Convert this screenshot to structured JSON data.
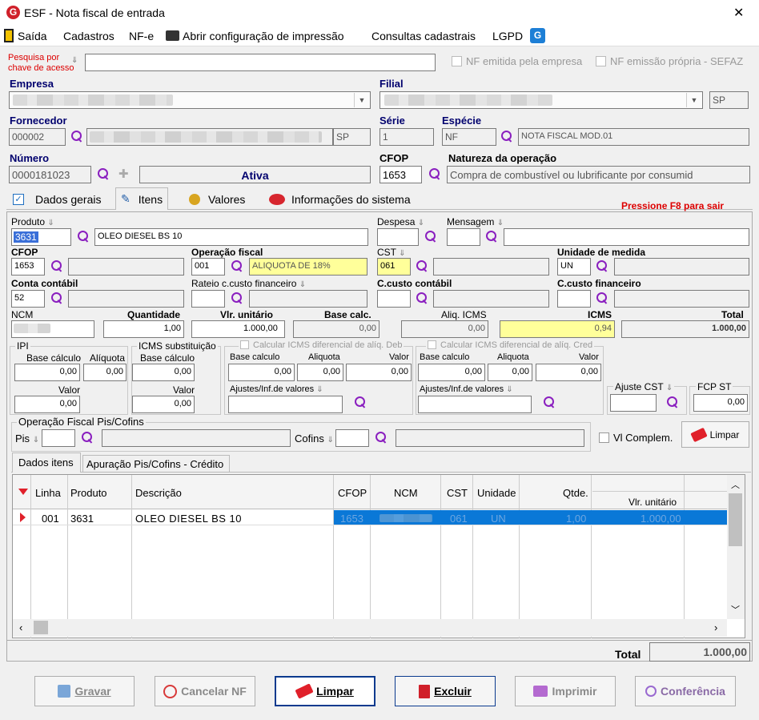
{
  "window": {
    "title": "ESF - Nota fiscal de entrada",
    "close": "✕"
  },
  "menu": {
    "saida": "Saída",
    "cadastros": "Cadastros",
    "nfe": "NF-e",
    "abrir": "Abrir configuração de impressão",
    "consultas": "Consultas cadastrais",
    "lgpd": "LGPD"
  },
  "search": {
    "label1": "Pesquisa por",
    "label2": "chave de acesso",
    "value": "",
    "nf_emitida": "NF emitida pela empresa",
    "nf_propria": "NF emissão própria - SEFAZ"
  },
  "header": {
    "empresa_label": "Empresa",
    "filial_label": "Filial",
    "filial_uf": "SP",
    "fornecedor_label": "Fornecedor",
    "fornecedor_code": "000002",
    "fornecedor_uf": "SP",
    "serie_label": "Série",
    "serie": "1",
    "especie_label": "Espécie",
    "especie": "NF",
    "especie_desc": "NOTA FISCAL MOD.01",
    "numero_label": "Número",
    "numero": "0000181023",
    "status": "Ativa",
    "cfop_label": "CFOP",
    "cfop": "1653",
    "natureza_label": "Natureza da operação",
    "natureza": "Compra de combustível ou lubrificante por consumid"
  },
  "tabs": {
    "dados": "Dados gerais",
    "itens": "Itens",
    "valores": "Valores",
    "info": "Informações do sistema",
    "hint": "Pressione F8 para sair"
  },
  "item": {
    "produto_label": "Produto",
    "produto": "3631",
    "produto_desc": "OLEO DIESEL BS 10",
    "despesa_label": "Despesa",
    "mensagem_label": "Mensagem",
    "cfop_label": "CFOP",
    "cfop": "1653",
    "opfiscal_label": "Operação fiscal",
    "opfiscal": "001",
    "opfiscal_desc": "ALIQUOTA DE 18%",
    "cst_label": "CST",
    "cst": "061",
    "unidade_label": "Unidade de medida",
    "unidade": "UN",
    "conta_label": "Conta contábil",
    "conta": "52",
    "rateio_label": "Rateio c.custo financeiro",
    "ccusto_cont_label": "C.custo contábil",
    "ccusto_fin_label": "C.custo financeiro",
    "ncm_label": "NCM",
    "qtd_label": "Quantidade",
    "qtd": "1,00",
    "vlr_label": "Vlr. unitário",
    "vlr": "1.000,00",
    "base_label": "Base calc.",
    "base": "0,00",
    "aliq_label": "Aliq. ICMS",
    "aliq": "0,00",
    "icms_label": "ICMS",
    "icms": "0,94",
    "total_label": "Total",
    "total": "1.000,00"
  },
  "ipi": {
    "title": "IPI",
    "base_label": "Base cálculo",
    "base": "0,00",
    "aliq_label": "Alíquota",
    "aliq": "0,00",
    "valor_label": "Valor",
    "valor": "0,00"
  },
  "icmsst": {
    "title": "ICMS substituição",
    "base_label": "Base cálculo",
    "base": "0,00",
    "valor_label": "Valor",
    "valor": "0,00"
  },
  "difdeb": {
    "title": "Calcular ICMS diferencial de alíq. Deb",
    "base_label": "Base calculo",
    "base": "0,00",
    "aliq_label": "Aliquota",
    "aliq": "0,00",
    "valor_label": "Valor",
    "valor": "0,00",
    "ajustes_label": "Ajustes/Inf.de valores"
  },
  "difcred": {
    "title": "Calcular ICMS diferencial de alíq. Cred",
    "base_label": "Base calculo",
    "base": "0,00",
    "aliq_label": "Aliquota",
    "aliq": "0,00",
    "valor_label": "Valor",
    "valor": "0,00",
    "ajustes_label": "Ajustes/Inf.de valores"
  },
  "ajuste": {
    "cst_label": "Ajuste CST",
    "fcp_label": "FCP ST",
    "fcp": "0,00"
  },
  "piscofins": {
    "title": "Operação Fiscal Pis/Cofins",
    "pis_label": "Pis",
    "cofins_label": "Cofins",
    "vl_compl": "Vl Complem.",
    "limpar": "Limpar"
  },
  "subtabs": {
    "dados": "Dados itens",
    "apuracao": "Apuração Pis/Cofins - Crédito"
  },
  "grid": {
    "columns": [
      "Linha",
      "Produto",
      "Descrição",
      "CFOP",
      "NCM",
      "CST",
      "Unidade",
      "Qtde.",
      "Vlr. unitário"
    ],
    "row": {
      "linha": "001",
      "produto": "3631",
      "descricao": "OLEO DIESEL BS 10",
      "cfop": "1653",
      "cst": "061",
      "unidade": "UN",
      "qtde": "1,00",
      "vlr": "1.000,00"
    }
  },
  "footer": {
    "total_label": "Total",
    "total": "1.000,00"
  },
  "buttons": {
    "gravar": "Gravar",
    "cancelar": "Cancelar NF",
    "limpar": "Limpar",
    "excluir": "Excluir",
    "imprimir": "Imprimir",
    "conferencia": "Conferência"
  }
}
